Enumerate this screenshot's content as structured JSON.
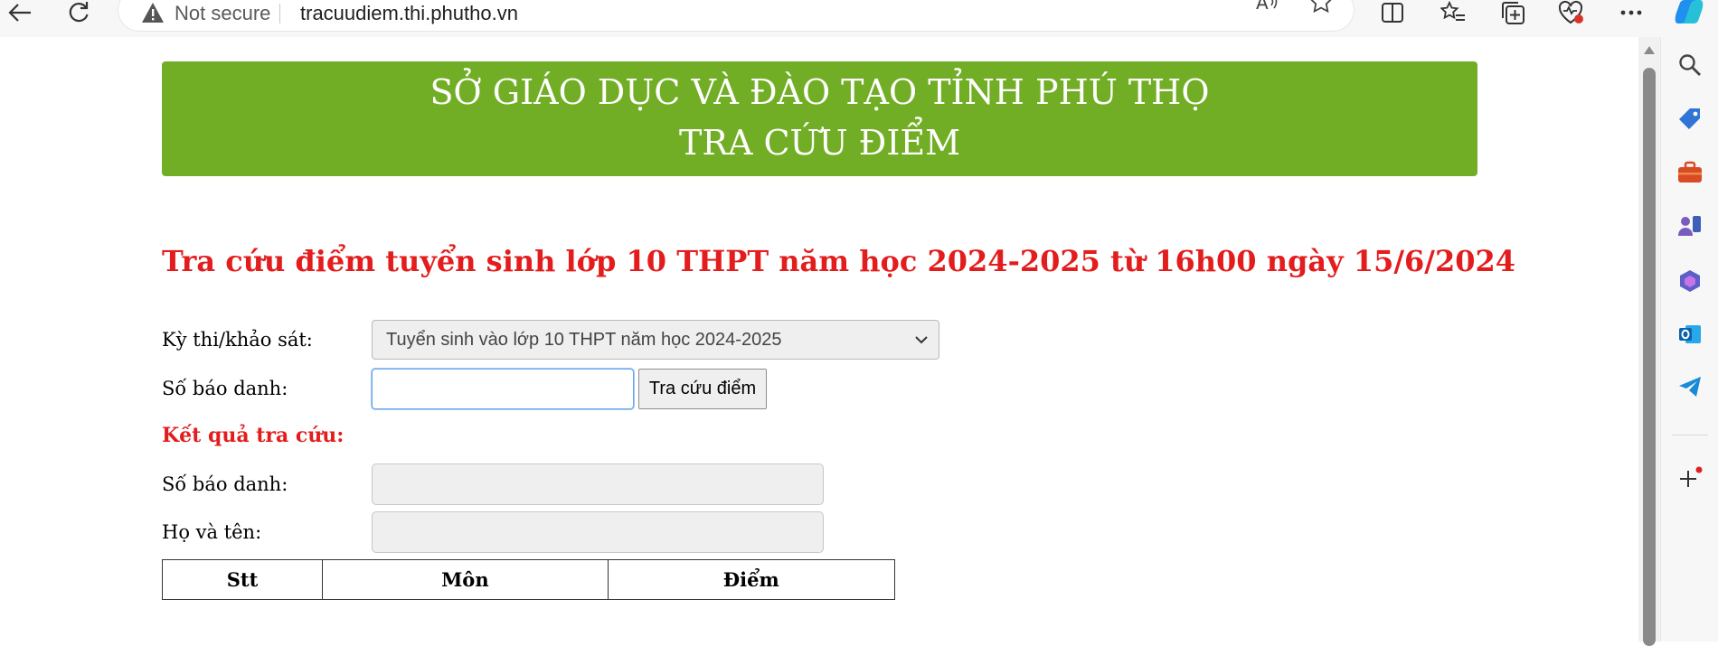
{
  "browser": {
    "not_secure_label": "Not secure",
    "url": "tracuudiem.thi.phutho.vn",
    "icons": [
      "back-icon",
      "refresh-icon",
      "warning-icon",
      "read-aloud-icon",
      "favorite-star-icon",
      "split-screen-icon",
      "favorites-icon",
      "collections-icon",
      "browser-essentials-icon",
      "more-icon",
      "copilot-icon"
    ]
  },
  "sidebar": {
    "icons": [
      "search-icon",
      "shopping-tag-icon",
      "tools-icon",
      "games-icon",
      "microsoft365-icon",
      "outlook-icon",
      "telegram-icon",
      "add-icon"
    ]
  },
  "banner": {
    "line1": "SỞ GIÁO DỤC VÀ ĐÀO TẠO TỈNH PHÚ THỌ",
    "line2": "TRA CỨU ĐIỂM"
  },
  "headline": "Tra cứu điểm tuyển sinh lớp 10 THPT năm học 2024-2025 từ 16h00 ngày 15/6/2024",
  "form": {
    "exam_label": "Kỳ thi/khảo sát:",
    "exam_selected": "Tuyển sinh vào lớp 10 THPT năm học 2024-2025",
    "sbd_label": "Số báo danh:",
    "sbd_value": "",
    "search_button": "Tra cứu điểm"
  },
  "result": {
    "title": "Kết quả tra cứu:",
    "sbd_label": "Số báo danh:",
    "name_label": "Họ và tên:",
    "table_headers": [
      "Stt",
      "Môn",
      "Điểm"
    ]
  },
  "colors": {
    "banner_green": "#72ae25",
    "headline_red": "#e31d1d"
  }
}
